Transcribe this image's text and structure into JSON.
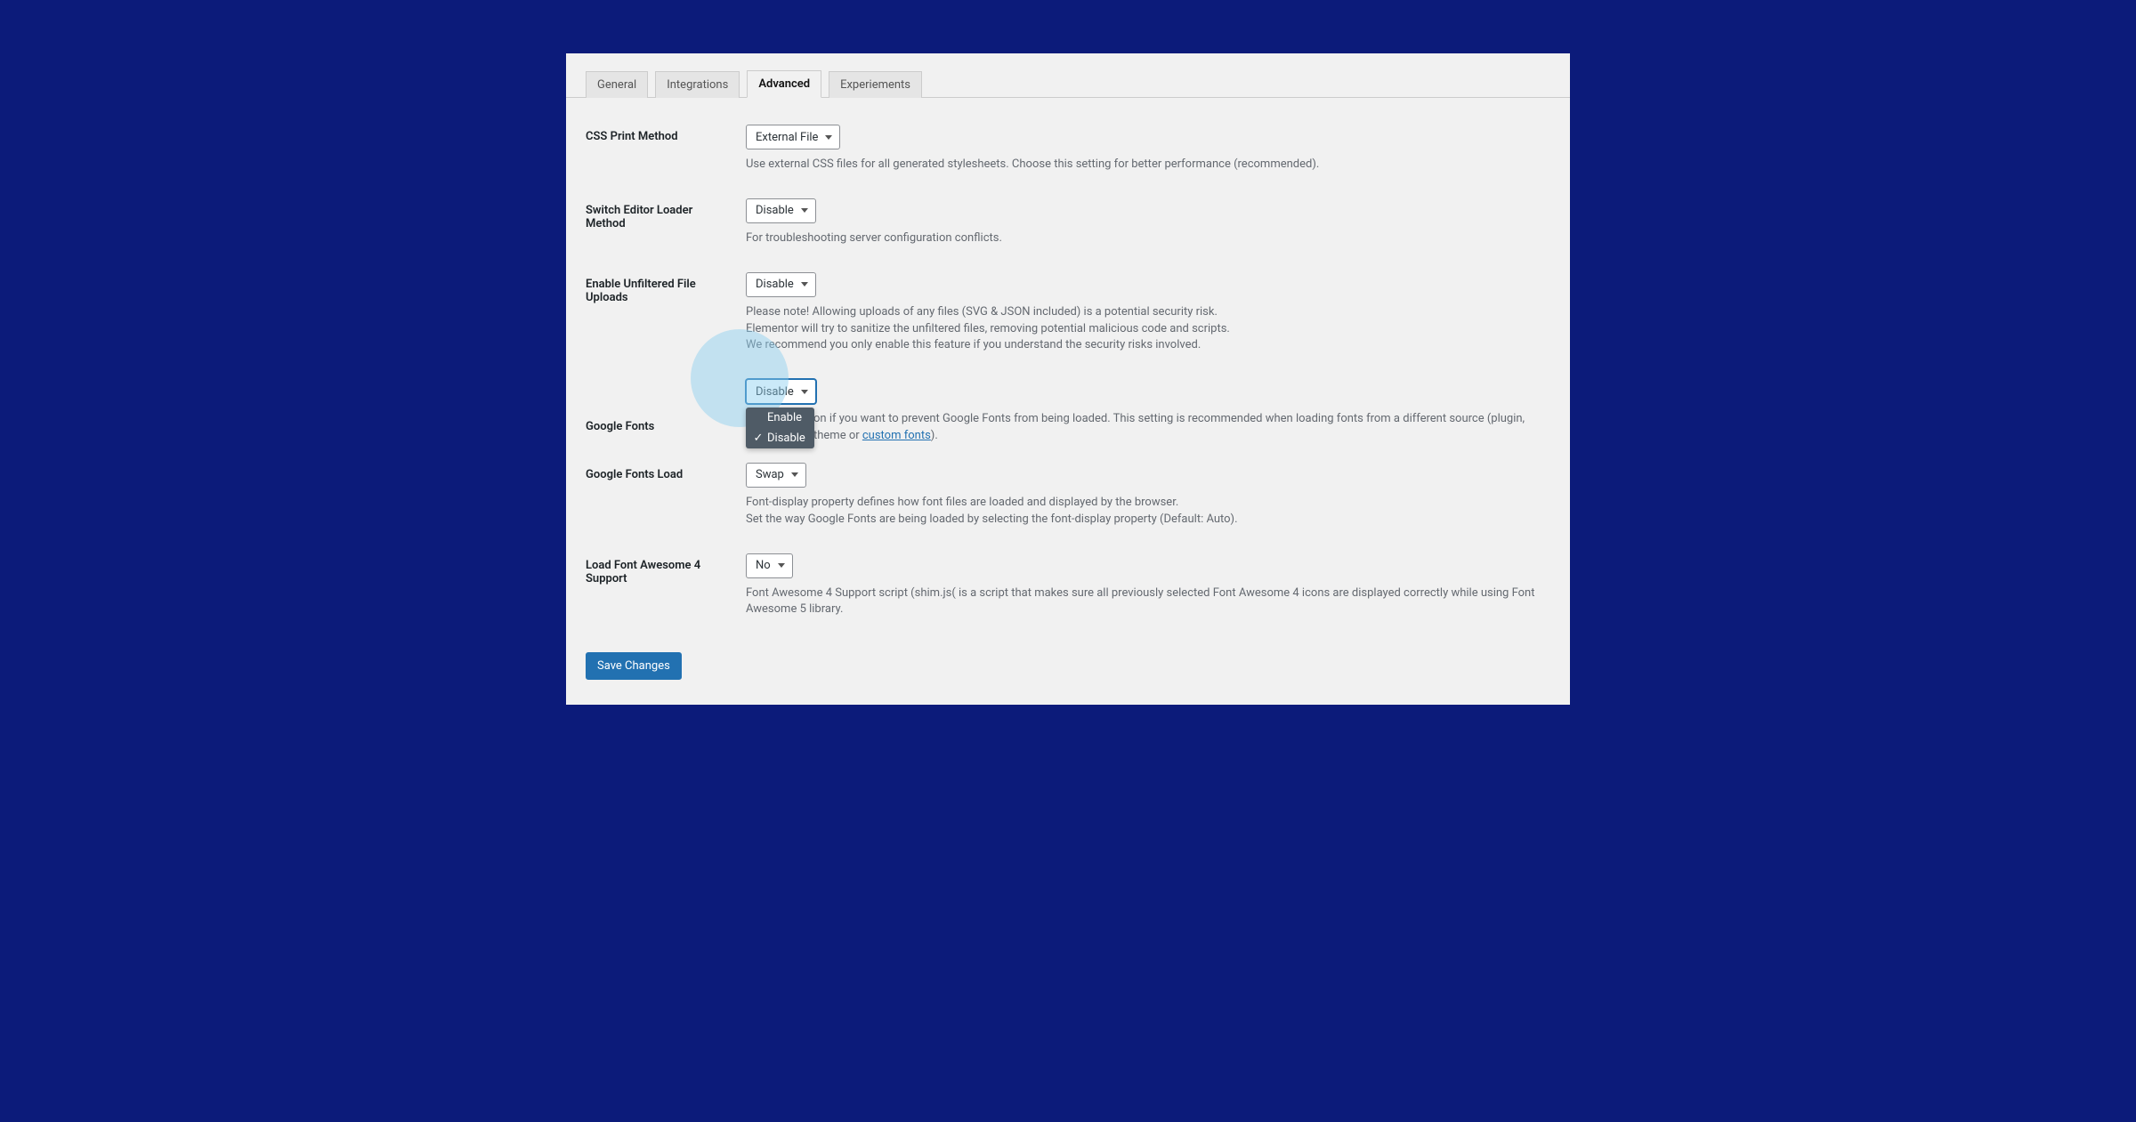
{
  "tabs": {
    "general": "General",
    "integrations": "Integrations",
    "advanced": "Advanced",
    "experiments": "Experiements"
  },
  "rows": {
    "css_print": {
      "label": "CSS Print Method",
      "value": "External File",
      "help": "Use external CSS files for all generated stylesheets. Choose this setting for better performance (recommended)."
    },
    "switch_editor": {
      "label": "Switch Editor Loader Method",
      "value": "Disable",
      "help": "For troubleshooting server configuration conflicts."
    },
    "unfiltered_uploads": {
      "label": "Enable Unfiltered File Uploads",
      "value": "Disable",
      "help1": "Please note! Allowing uploads of any files (SVG & JSON included) is a potential security risk.",
      "help2": "Elementor will try to sanitize the unfiltered files, removing potential malicious code and scripts.",
      "help3": "We recommend you only enable this feature if you understand the security risks involved."
    },
    "google_fonts": {
      "label": "Google Fonts",
      "value": "Disable",
      "options": {
        "enable": "Enable",
        "disable": "Disable"
      },
      "help_pre": "on if you want to prevent Google Fonts from being loaded. This setting is recommended when loading fonts from a different source (plugin, theme or ",
      "help_link": "custom fonts",
      "help_post": ")."
    },
    "google_fonts_load": {
      "label": "Google Fonts Load",
      "value": "Swap",
      "help1": "Font-display property defines how font files are loaded and displayed by the browser.",
      "help2": "Set the way Google Fonts are being loaded by selecting the font-display property (Default: Auto)."
    },
    "fa4": {
      "label": "Load Font Awesome 4 Support",
      "value": "No",
      "help": "Font Awesome 4 Support script (shim.js( is a script that makes sure all previously selected Font Awesome 4 icons are displayed correctly while using Font Awesome 5 library."
    }
  },
  "save_button": "Save Changes"
}
